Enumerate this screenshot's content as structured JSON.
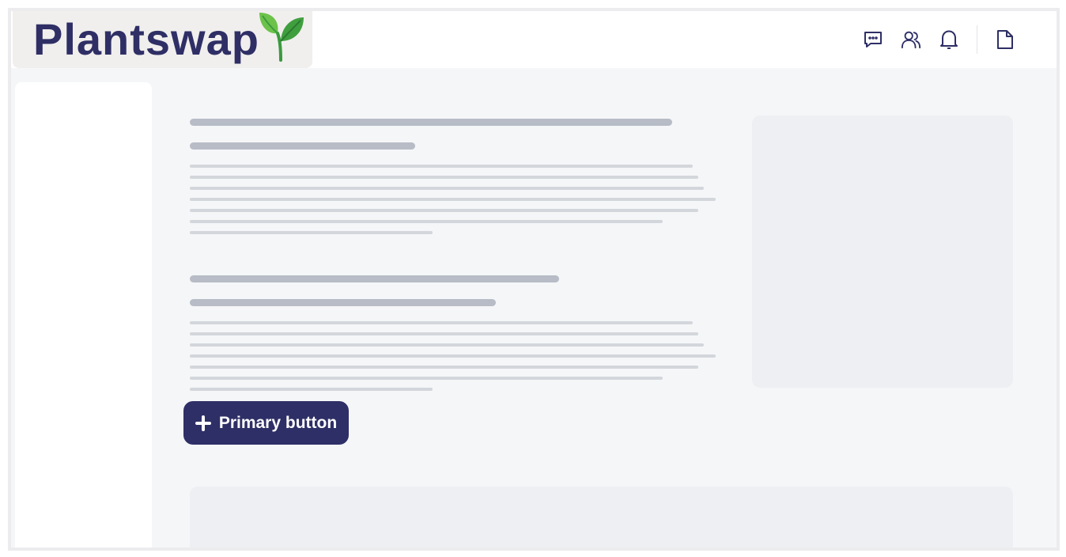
{
  "header": {
    "logo_text": "Plantswap",
    "icons": [
      "chat-icon",
      "users-icon",
      "bell-icon",
      "document-icon"
    ]
  },
  "main": {
    "primary_button_label": "Primary button",
    "primary_button_icon": "plus-icon"
  },
  "colors": {
    "brand": "#2e2f66",
    "leaf_light": "#6cc24a",
    "leaf_dark": "#3a9a3e",
    "background": "#f5f6f8",
    "skeleton_heading": "#b7bcc6",
    "skeleton_line": "#d3d6db"
  }
}
